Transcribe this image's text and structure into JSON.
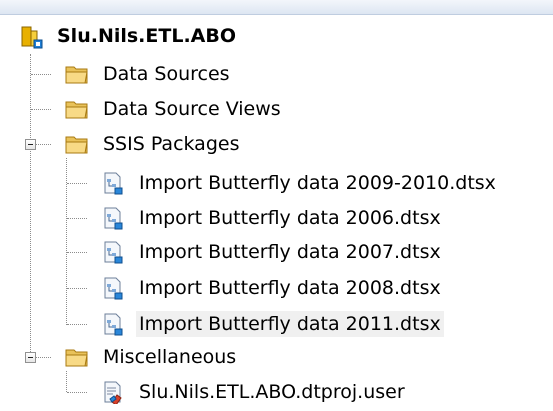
{
  "tree": {
    "root": {
      "label": "Slu.Nils.ETL.ABO",
      "icon": "project-icon"
    },
    "items": [
      {
        "label": "Data Sources",
        "icon": "folder-icon"
      },
      {
        "label": "Data Source Views",
        "icon": "folder-icon"
      },
      {
        "label": "SSIS Packages",
        "icon": "folder-icon",
        "expanded": true,
        "children": [
          {
            "label": "Import Butterfly data 2009-2010.dtsx",
            "icon": "package-icon"
          },
          {
            "label": "Import Butterfly data 2006.dtsx",
            "icon": "package-icon"
          },
          {
            "label": "Import Butterfly data 2007.dtsx",
            "icon": "package-icon"
          },
          {
            "label": "Import Butterfly data 2008.dtsx",
            "icon": "package-icon"
          },
          {
            "label": "Import Butterfly data 2011.dtsx",
            "icon": "package-icon",
            "selected": true
          }
        ]
      },
      {
        "label": "Miscellaneous",
        "icon": "folder-icon",
        "expanded": true,
        "children": [
          {
            "label": "Slu.Nils.ETL.ABO.dtproj.user",
            "icon": "user-file-icon"
          }
        ]
      }
    ]
  }
}
